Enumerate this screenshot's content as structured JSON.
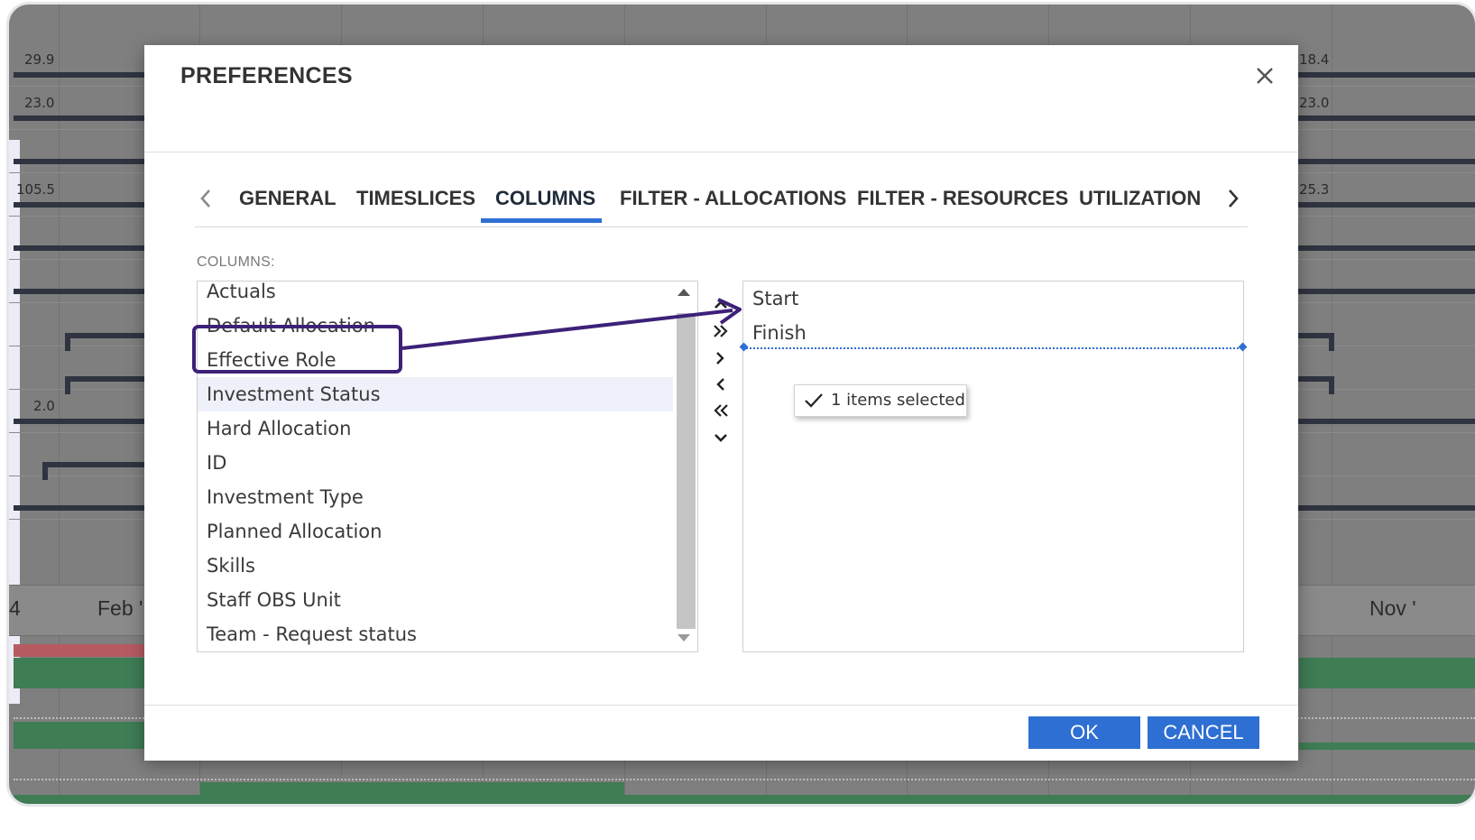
{
  "background": {
    "y_values_left": [
      "29.9",
      "23.0",
      "105.5",
      "2.0"
    ],
    "y_values_right": [
      "18.4",
      "23.0",
      "25.3"
    ],
    "axis_labels": [
      "4",
      "Feb '",
      "Nov '"
    ]
  },
  "dialog": {
    "title": "PREFERENCES",
    "close_icon": "close-icon",
    "tabs": [
      {
        "label": "GENERAL",
        "active": false
      },
      {
        "label": "TIMESLICES",
        "active": false
      },
      {
        "label": "COLUMNS",
        "active": true
      },
      {
        "label": "FILTER - ALLOCATIONS",
        "active": false
      },
      {
        "label": "FILTER - RESOURCES",
        "active": false
      },
      {
        "label": "UTILIZATION",
        "active": false
      }
    ],
    "columns_label": "COLUMNS:",
    "available_columns": [
      "Actuals",
      "Default Allocation",
      "Effective Role",
      "Investment Status",
      "Hard Allocation",
      "ID",
      "Investment Type",
      "Planned Allocation",
      "Skills",
      "Staff OBS Unit",
      "Team - Request status"
    ],
    "selected_available": "Investment Status",
    "selected_columns": [
      "Start",
      "Finish"
    ],
    "drag_tooltip": "1 items selected",
    "ok_label": "OK",
    "cancel_label": "CANCEL",
    "accent_color": "#2e6fd3",
    "annotation_color": "#3d2178"
  }
}
